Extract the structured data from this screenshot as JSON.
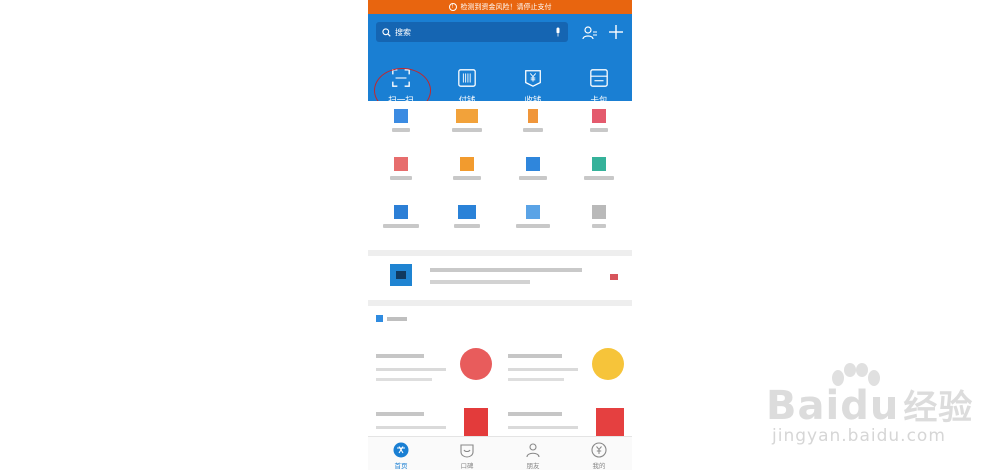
{
  "status_bar": {
    "warning_text": "检测到资金风险！请停止支付"
  },
  "search": {
    "placeholder": "搜索"
  },
  "quick_actions": [
    {
      "label": "扫一扫",
      "icon": "scan-icon"
    },
    {
      "label": "付钱",
      "icon": "barcode-icon"
    },
    {
      "label": "收钱",
      "icon": "yuan-receive-icon"
    },
    {
      "label": "卡包",
      "icon": "card-wallet-icon"
    }
  ],
  "tabs": [
    {
      "label": "首页",
      "icon": "home-icon",
      "active": true
    },
    {
      "label": "口碑",
      "icon": "koubei-icon",
      "active": false
    },
    {
      "label": "朋友",
      "icon": "friends-icon",
      "active": false
    },
    {
      "label": "我的",
      "icon": "profile-icon",
      "active": false
    }
  ],
  "watermark": {
    "main": "Bai",
    "main2": "du",
    "cn": "经验",
    "sub": "jingyan.baidu.com"
  },
  "colors": {
    "brand_blue": "#1a7fd3",
    "search_blue": "#1565b2",
    "warning_orange": "#e8650f",
    "annotation_red": "#c1272d"
  }
}
